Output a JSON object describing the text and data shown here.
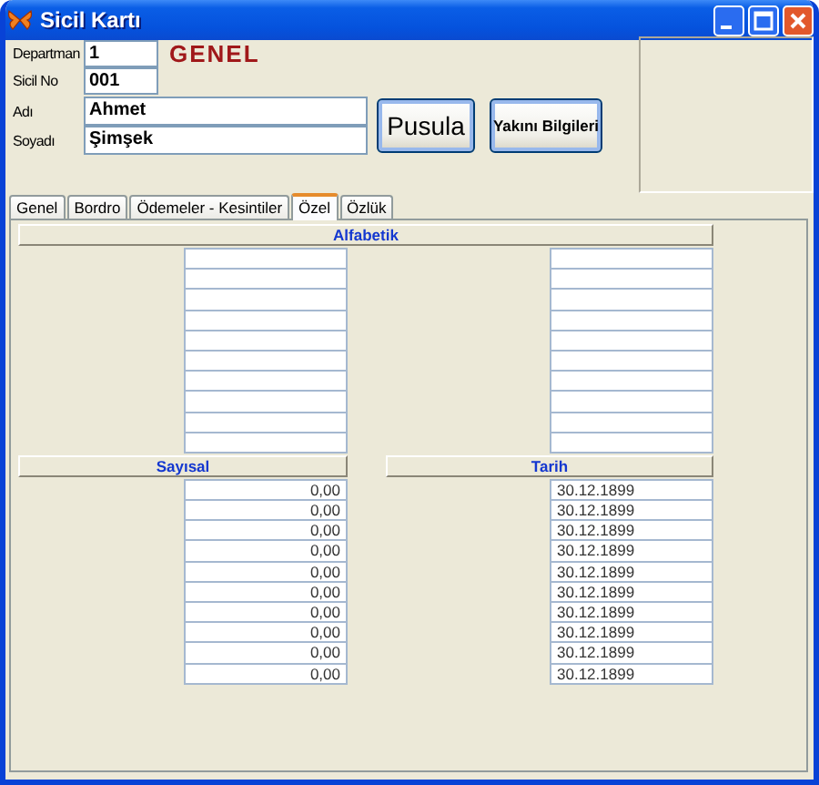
{
  "window": {
    "title": "Sicil Kartı"
  },
  "header_fields": [
    {
      "label": "Departman",
      "value": "1"
    },
    {
      "label": "Sicil No",
      "value": "001"
    },
    {
      "label": "Adı",
      "value": "Ahmet"
    },
    {
      "label": "Soyadı",
      "value": "Şimşek"
    }
  ],
  "section_label": "GENEL",
  "buttons": [
    {
      "label": "Pusula",
      "kind": "large"
    },
    {
      "label": "Yakını Bilgileri",
      "kind": "small"
    }
  ],
  "tabs": [
    {
      "label": "Genel",
      "selected": false
    },
    {
      "label": "Bordro",
      "selected": false
    },
    {
      "label": "Ödemeler - Kesintiler",
      "selected": false
    },
    {
      "label": "Özel",
      "selected": true
    },
    {
      "label": "Özlük",
      "selected": false
    }
  ],
  "alphabetic": {
    "title": "Alfabetik",
    "left_fields": [
      {
        "kind": "text"
      },
      {
        "kind": "text"
      },
      {
        "kind": "text"
      },
      {
        "kind": "text"
      },
      {
        "kind": "text"
      },
      {
        "kind": "text"
      },
      {
        "kind": "text"
      },
      {
        "kind": "text"
      },
      {
        "kind": "text"
      },
      {
        "kind": "text"
      }
    ],
    "right_fields": [
      {
        "kind": "text"
      },
      {
        "kind": "text"
      },
      {
        "kind": "text"
      },
      {
        "kind": "text"
      },
      {
        "kind": "text"
      },
      {
        "kind": "text"
      },
      {
        "kind": "text"
      },
      {
        "kind": "text"
      },
      {
        "kind": "text"
      },
      {
        "kind": "text"
      }
    ]
  },
  "numeric": {
    "title": "Sayısal",
    "fields": [
      {
        "kind": "number",
        "value": "0,00"
      },
      {
        "kind": "number",
        "value": "0,00"
      },
      {
        "kind": "number",
        "value": "0,00"
      },
      {
        "kind": "number",
        "value": "0,00"
      },
      {
        "kind": "number",
        "value": "0,00"
      },
      {
        "kind": "number",
        "value": "0,00"
      },
      {
        "kind": "number",
        "value": "0,00"
      },
      {
        "kind": "number",
        "value": "0,00"
      },
      {
        "kind": "number",
        "value": "0,00"
      },
      {
        "kind": "number",
        "value": "0,00"
      }
    ]
  },
  "date": {
    "title": "Tarih",
    "fields": [
      {
        "kind": "date",
        "value": "30.12.1899"
      },
      {
        "kind": "date",
        "value": "30.12.1899"
      },
      {
        "kind": "date",
        "value": "30.12.1899"
      },
      {
        "kind": "date",
        "value": "30.12.1899"
      },
      {
        "kind": "date",
        "value": "30.12.1899"
      },
      {
        "kind": "date",
        "value": "30.12.1899"
      },
      {
        "kind": "date",
        "value": "30.12.1899"
      },
      {
        "kind": "date",
        "value": "30.12.1899"
      },
      {
        "kind": "date",
        "value": "30.12.1899"
      },
      {
        "kind": "date",
        "value": "30.12.1899"
      }
    ]
  }
}
